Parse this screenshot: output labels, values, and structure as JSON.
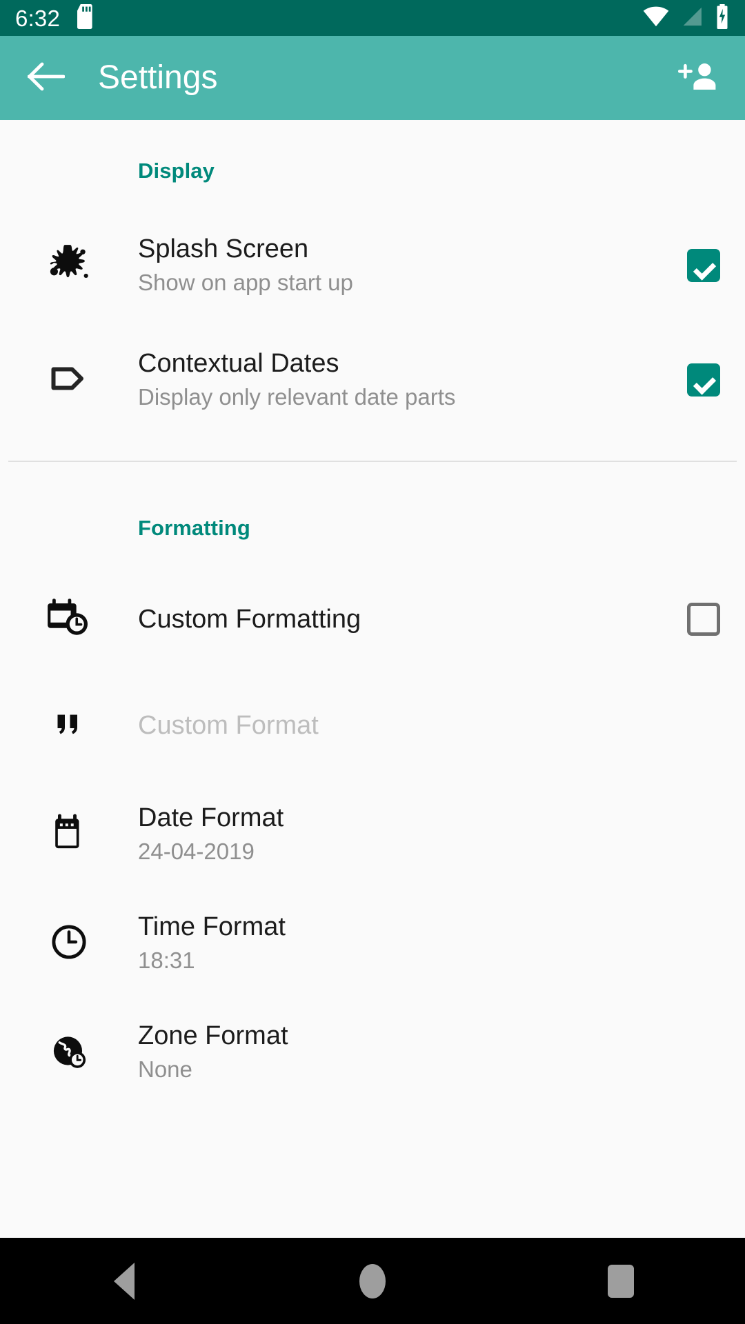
{
  "status_bar": {
    "clock": "6:32",
    "bg_color": "#00695c",
    "icons": [
      "sd-card-icon",
      "wifi-icon",
      "cell-signal-icon",
      "battery-charging-icon"
    ]
  },
  "app_bar": {
    "title": "Settings",
    "bg_color": "#4db6ac",
    "back_icon": "arrow-left-icon",
    "actions": [
      {
        "icon": "add-person-icon",
        "name": "add-contact-button"
      }
    ]
  },
  "theme": {
    "accent": "#00897b",
    "section_header_color": "#00897b",
    "checkbox_on_color": "#00897b",
    "checkbox_off_color": "#707070",
    "page_bg": "#fafafa",
    "title_color": "#1c1c1c",
    "subtitle_color": "#8f8f8f",
    "disabled_color": "#bdbdbd"
  },
  "sections": [
    {
      "header": "Display",
      "rows": [
        {
          "title": "Splash Screen",
          "subtitle": "Show on app start up",
          "icon": "splash-icon",
          "control": "checkbox",
          "checked": true,
          "enabled": true
        },
        {
          "title": "Contextual Dates",
          "subtitle": "Display only relevant date parts",
          "icon": "tag-icon",
          "control": "checkbox",
          "checked": true,
          "enabled": true
        }
      ]
    },
    {
      "header": "Formatting",
      "rows": [
        {
          "title": "Custom Formatting",
          "subtitle": "",
          "icon": "calendar-clock-icon",
          "control": "checkbox",
          "checked": false,
          "enabled": true
        },
        {
          "title": "Custom Format",
          "subtitle": "",
          "icon": "quote-icon",
          "control": "none",
          "checked": false,
          "enabled": false
        },
        {
          "title": "Date Format",
          "subtitle": "24-04-2019",
          "icon": "calendar-icon",
          "control": "none",
          "enabled": true
        },
        {
          "title": "Time Format",
          "subtitle": "18:31",
          "icon": "clock-icon",
          "control": "none",
          "enabled": true
        },
        {
          "title": "Zone Format",
          "subtitle": "None",
          "icon": "globe-clock-icon",
          "control": "none",
          "enabled": true
        }
      ]
    }
  ],
  "nav_bar": {
    "bg_color": "#000000",
    "buttons": [
      {
        "name": "nav-back-button",
        "icon": "triangle-left-icon"
      },
      {
        "name": "nav-home-button",
        "icon": "circle-icon"
      },
      {
        "name": "nav-recents-button",
        "icon": "square-icon"
      }
    ]
  }
}
